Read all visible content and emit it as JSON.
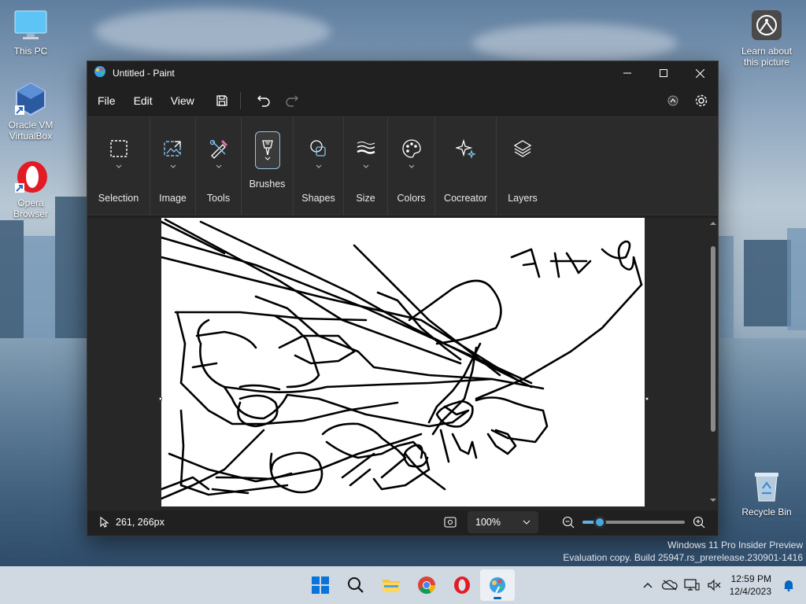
{
  "desktop": {
    "icons": [
      {
        "label": "This PC"
      },
      {
        "label": "Oracle VM VirtualBox"
      },
      {
        "label": "Opera Browser"
      },
      {
        "label": "Learn about this picture"
      },
      {
        "label": "Recycle Bin"
      }
    ]
  },
  "window": {
    "title": "Untitled - Paint",
    "menu": {
      "file": "File",
      "edit": "Edit",
      "view": "View"
    },
    "ribbon": [
      {
        "label": "Selection",
        "icon": "selection-icon"
      },
      {
        "label": "Image",
        "icon": "image-icon"
      },
      {
        "label": "Tools",
        "icon": "tools-icon"
      },
      {
        "label": "Brushes",
        "icon": "brush-icon"
      },
      {
        "label": "Shapes",
        "icon": "shapes-icon"
      },
      {
        "label": "Size",
        "icon": "size-icon"
      },
      {
        "label": "Colors",
        "icon": "palette-icon"
      },
      {
        "label": "Cocreator",
        "icon": "sparkle-icon"
      },
      {
        "label": "Layers",
        "icon": "layers-icon"
      }
    ],
    "status": {
      "cursor_position": "261, 266px",
      "zoom": "100%",
      "zoom_fraction": 0.17
    }
  },
  "watermark": {
    "line1": "Windows 11 Pro Insider Preview",
    "line2": "Evaluation copy. Build 25947.rs_prerelease.230901-1416"
  },
  "taskbar": {
    "time": "12:59 PM",
    "date": "12/4/2023"
  },
  "colors": {
    "accent": "#0067c0",
    "ribbon_highlight": "#8fc7e6",
    "slider": "#4aa6e0"
  }
}
